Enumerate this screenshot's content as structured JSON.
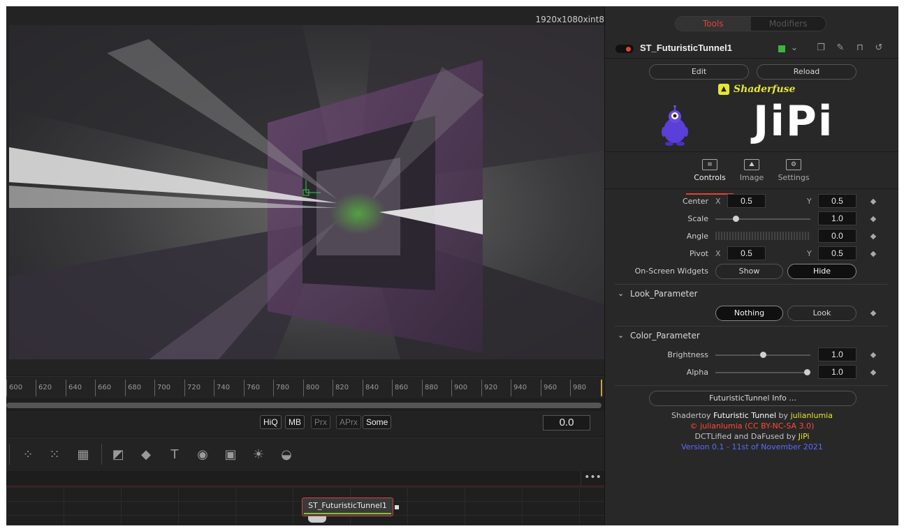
{
  "viewer": {
    "resolution": "1920x1080xint8"
  },
  "ruler": {
    "ticks": [
      "600",
      "620",
      "640",
      "660",
      "680",
      "700",
      "720",
      "740",
      "760",
      "780",
      "800",
      "820",
      "840",
      "860",
      "880",
      "900",
      "920",
      "940",
      "960",
      "980"
    ]
  },
  "transport": {
    "buttons": [
      "HiQ",
      "MB",
      "Prx",
      "APrx",
      "Some"
    ],
    "time": "0.0"
  },
  "toolbar": {
    "tools": [
      "particles-icon",
      "particle-emitter-icon",
      "particle-render-icon",
      "image-plane-icon",
      "shape3d-icon",
      "text3d-icon",
      "merge3d-icon",
      "renderer3d-icon",
      "light-icon",
      "camera-icon"
    ]
  },
  "nodes": {
    "node_label": "ST_FuturisticTunnel1",
    "more": "•••"
  },
  "inspector": {
    "tabs_top": {
      "tools": "Tools",
      "modifiers": "Modifiers"
    },
    "tool_name": "ST_FuturisticTunnel1",
    "tool_color": "#3cb53c",
    "edit": "Edit",
    "reload": "Reload",
    "brand": "Shaderfuse",
    "logo": "JiPi",
    "tabs": {
      "controls": "Controls",
      "image": "Image",
      "settings": "Settings"
    },
    "center": {
      "label": "Center",
      "x_label": "X",
      "x": "0.5",
      "y_label": "Y",
      "y": "0.5"
    },
    "scale": {
      "label": "Scale",
      "value": "1.0",
      "level": 0.2
    },
    "angle": {
      "label": "Angle",
      "value": "0.0"
    },
    "pivot": {
      "label": "Pivot",
      "x_label": "X",
      "x": "0.5",
      "y_label": "Y",
      "y": "0.5"
    },
    "widgets": {
      "label": "On-Screen Widgets",
      "show": "Show",
      "hide": "Hide"
    },
    "look_section": {
      "title": "Look_Parameter",
      "nothing": "Nothing",
      "look": "Look"
    },
    "color_section": {
      "title": "Color_Parameter"
    },
    "brightness": {
      "label": "Brightness",
      "value": "1.0",
      "level": 0.5
    },
    "alpha": {
      "label": "Alpha",
      "value": "1.0",
      "level": 1.0
    },
    "info_button": "FuturisticTunnel Info ...",
    "credits": {
      "line1_pre": "Shadertoy ",
      "line1_title": "Futuristic Tunnel",
      "line1_by": " by ",
      "line1_author": "julianlumia",
      "line2": "© julianlumia (CC BY-NC-SA 3.0)",
      "line3_pre": "DCTLified and DaFused by ",
      "line3_author": "JiPi",
      "line4": "Version 0.1 - 11st of November 2021"
    }
  },
  "colors": {
    "accent": "#e0433a",
    "yellow": "#e6e632",
    "blue": "#5a6cff",
    "background": "#1e1e1e"
  }
}
